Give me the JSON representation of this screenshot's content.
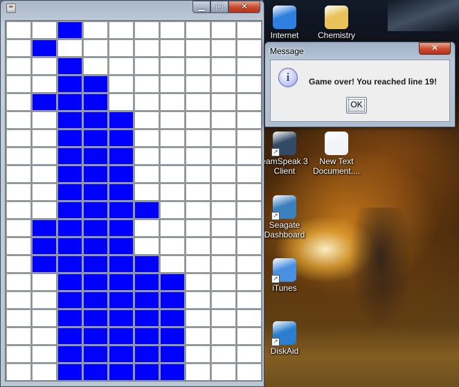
{
  "game": {
    "cols": 10,
    "rows": 20,
    "filled_color": "#0000ff",
    "empty_color": "#ffffff",
    "grid": [
      "0010000000",
      "0100000000",
      "0010000000",
      "0011000000",
      "0111000000",
      "0011100000",
      "0011100000",
      "0011100000",
      "0011100000",
      "0011100000",
      "0011110000",
      "0111100000",
      "0111100000",
      "0111110000",
      "0011111000",
      "0011111000",
      "0011111000",
      "0011111000",
      "0011111000",
      "0011111000"
    ]
  },
  "game_window": {
    "min_icon": "minimize-icon",
    "max_icon": "maximize-icon",
    "close_icon": "close-icon",
    "min_glyph": "▁",
    "max_glyph": "□",
    "close_glyph": "✕"
  },
  "dialog": {
    "title": "Message",
    "message": "Game over! You reached line 19!",
    "ok_label": "OK",
    "close_glyph": "✕",
    "info_glyph": "i"
  },
  "desktop_icons": [
    {
      "label": "Internet",
      "icon": "internet-explorer-icon",
      "color": "#2f7fe0",
      "shortcut": false
    },
    {
      "label": "Chemistry",
      "icon": "folder-icon",
      "color": "#e8c35a",
      "shortcut": false
    },
    {
      "label": "eamSpeak 3 Client",
      "icon": "teamspeak-icon",
      "color": "#334a66",
      "shortcut": true
    },
    {
      "label": "New Text Document....",
      "icon": "text-document-icon",
      "color": "#f2f4f8",
      "shortcut": false
    },
    {
      "label": "Seagate Dashboard",
      "icon": "seagate-dashboard-icon",
      "color": "#3d7fbf",
      "shortcut": true
    },
    {
      "label": "iTunes",
      "icon": "itunes-icon",
      "color": "#4a8fe0",
      "shortcut": true
    },
    {
      "label": "DiskAid",
      "icon": "diskaid-icon",
      "color": "#2c7fd0",
      "shortcut": true
    }
  ]
}
